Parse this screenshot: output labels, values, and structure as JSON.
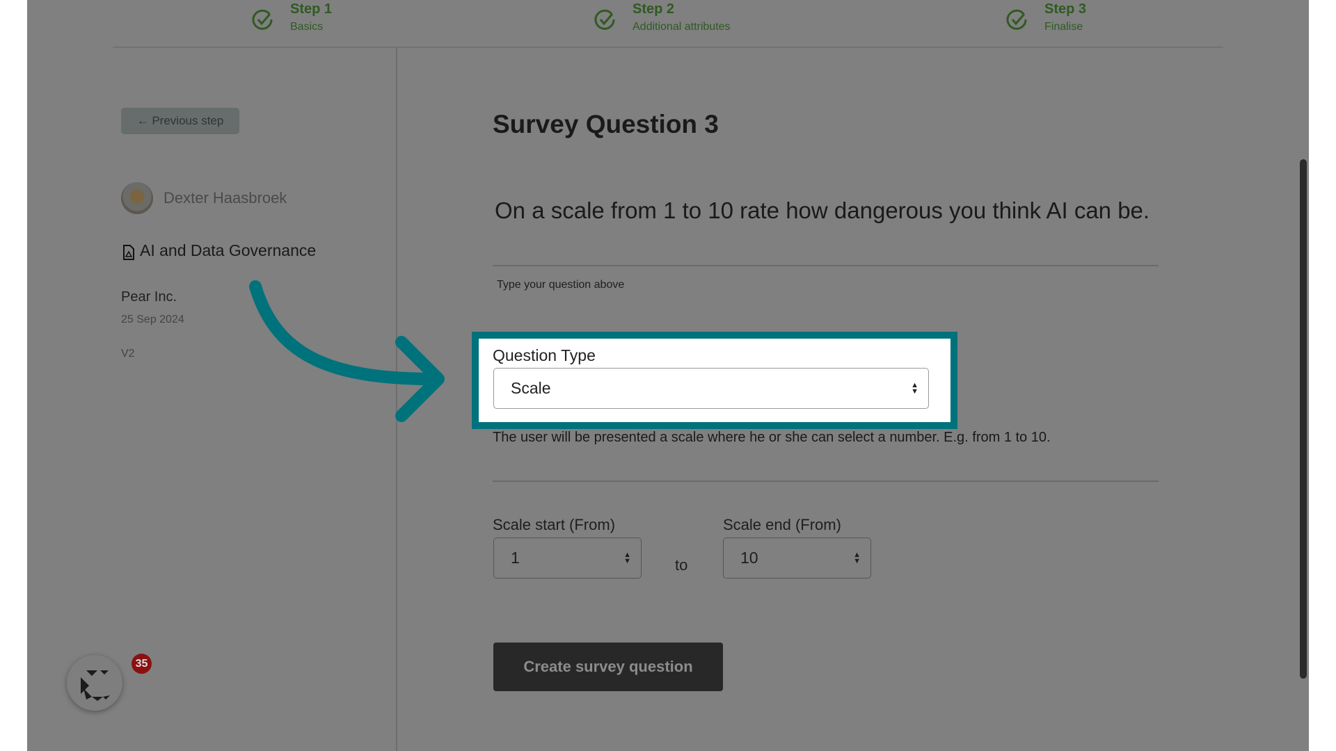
{
  "steps": [
    {
      "title": "Step 1",
      "subtitle": "Basics",
      "icon": "check-circle-icon"
    },
    {
      "title": "Step 2",
      "subtitle": "Additional attributes",
      "icon": "check-circle-icon"
    },
    {
      "title": "Step 3",
      "subtitle": "Finalise",
      "icon": "check-circle-icon"
    }
  ],
  "sidebar": {
    "previous_step": "← Previous step",
    "user_name": "Dexter Haasbroek",
    "survey_name": "AI and Data Governance",
    "company": "Pear Inc.",
    "date": "25 Sep 2024",
    "version": "V2"
  },
  "main": {
    "title": "Survey Question 3",
    "question": "On a scale from 1 to 10 rate how dangerous you think AI can be.",
    "question_hint": "Type your question above",
    "question_type_label": "Question Type",
    "question_type_value": "Scale",
    "question_type_help": "The user will be presented a scale where he or she can select a number. E.g. from 1 to 10.",
    "scale_start_label": "Scale start (From)",
    "scale_start_value": "1",
    "to_label": "to",
    "scale_end_label": "Scale end (From)",
    "scale_end_value": "10",
    "create_button": "Create survey question"
  },
  "widget": {
    "badge_count": "35"
  },
  "colors": {
    "highlight": "#00727c",
    "overlay": "#808080",
    "step_green": "#2f5a22",
    "badge": "#8b1010"
  }
}
